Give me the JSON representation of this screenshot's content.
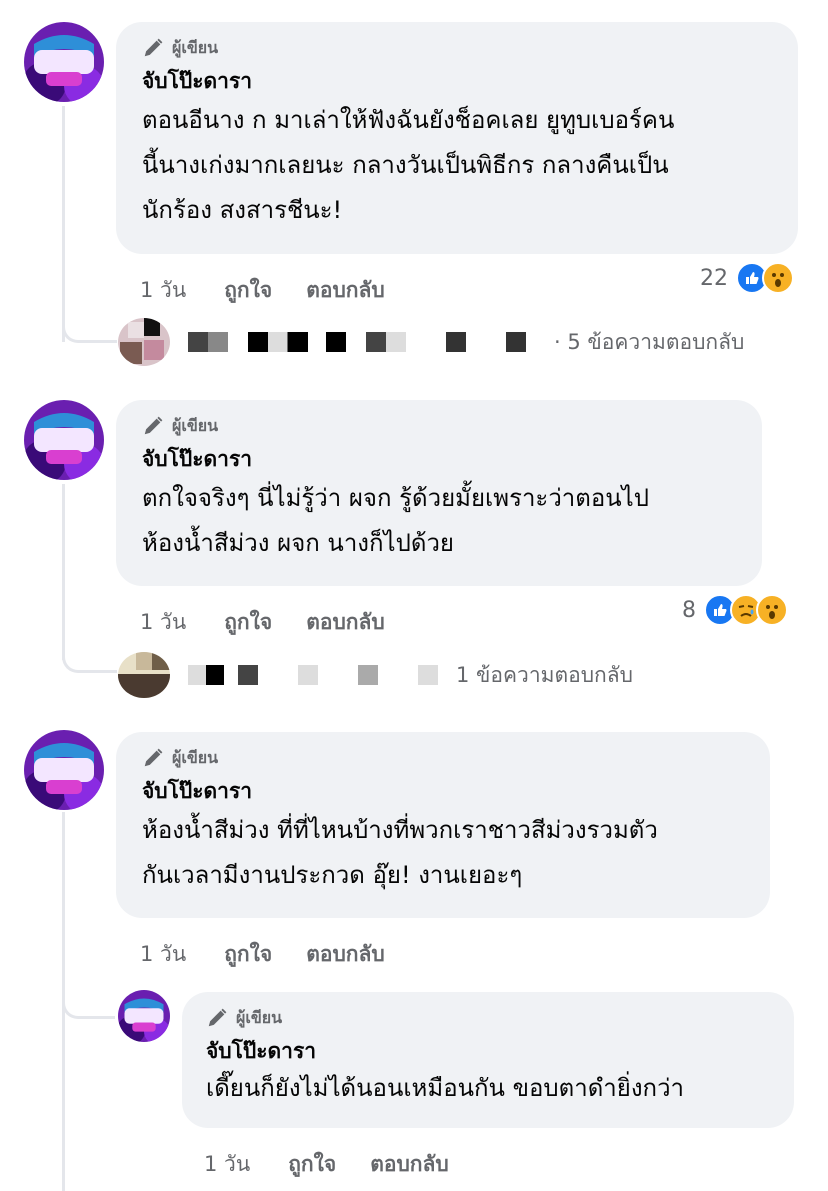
{
  "author_badge": "ผู้เขียน",
  "actions": {
    "like": "ถูกใจ",
    "reply": "ตอบกลับ"
  },
  "comments": [
    {
      "name": "จับโป๊ะดารา",
      "text_lines": [
        "ตอนอีนาง ก มาเล่าให้ฟังฉันยังช็อคเลย ยูทูบเบอร์คน",
        "นี้นางเก่งมากเลยนะ กลางวันเป็นพิธีกร กลางคืนเป็น",
        "นักร้อง สงสารชีนะ!"
      ],
      "time": "1 วัน",
      "reaction_count": "22",
      "reactions": [
        "like-icon",
        "wow-icon"
      ],
      "replies_text": "· 5 ข้อความตอบกลับ"
    },
    {
      "name": "จับโป๊ะดารา",
      "text_lines": [
        "ตกใจจริงๆ นี่ไม่รู้ว่า ผจก รู้ด้วยมั้ยเพราะว่าตอนไป",
        "ห้องน้ำสีม่วง ผจก นางก็ไปด้วย"
      ],
      "time": "1 วัน",
      "reaction_count": "8",
      "reactions": [
        "like-icon",
        "sad-icon",
        "wow-icon"
      ],
      "replies_text": "1 ข้อความตอบกลับ"
    },
    {
      "name": "จับโป๊ะดารา",
      "text_lines": [
        "ห้องน้ำสีม่วง ที่ที่ไหนบ้างที่พวกเราชาวสีม่วงรวมตัว",
        "กันเวลามีงานประกวด อุ๊ย! งานเยอะๆ"
      ],
      "time": "1 วัน"
    }
  ],
  "nested_reply": {
    "name": "จับโป๊ะดารา",
    "text_lines": [
      "เดี๊ยนก็ยังไม่ได้นอนเหมือนกัน ขอบตาดำยิ่งกว่า"
    ],
    "time": "1 วัน"
  },
  "colors": {
    "like_blue": "#1877f2",
    "wow_yellow": "#f7b125",
    "bubble_bg": "#f0f2f5",
    "meta_gray": "#65676b"
  }
}
